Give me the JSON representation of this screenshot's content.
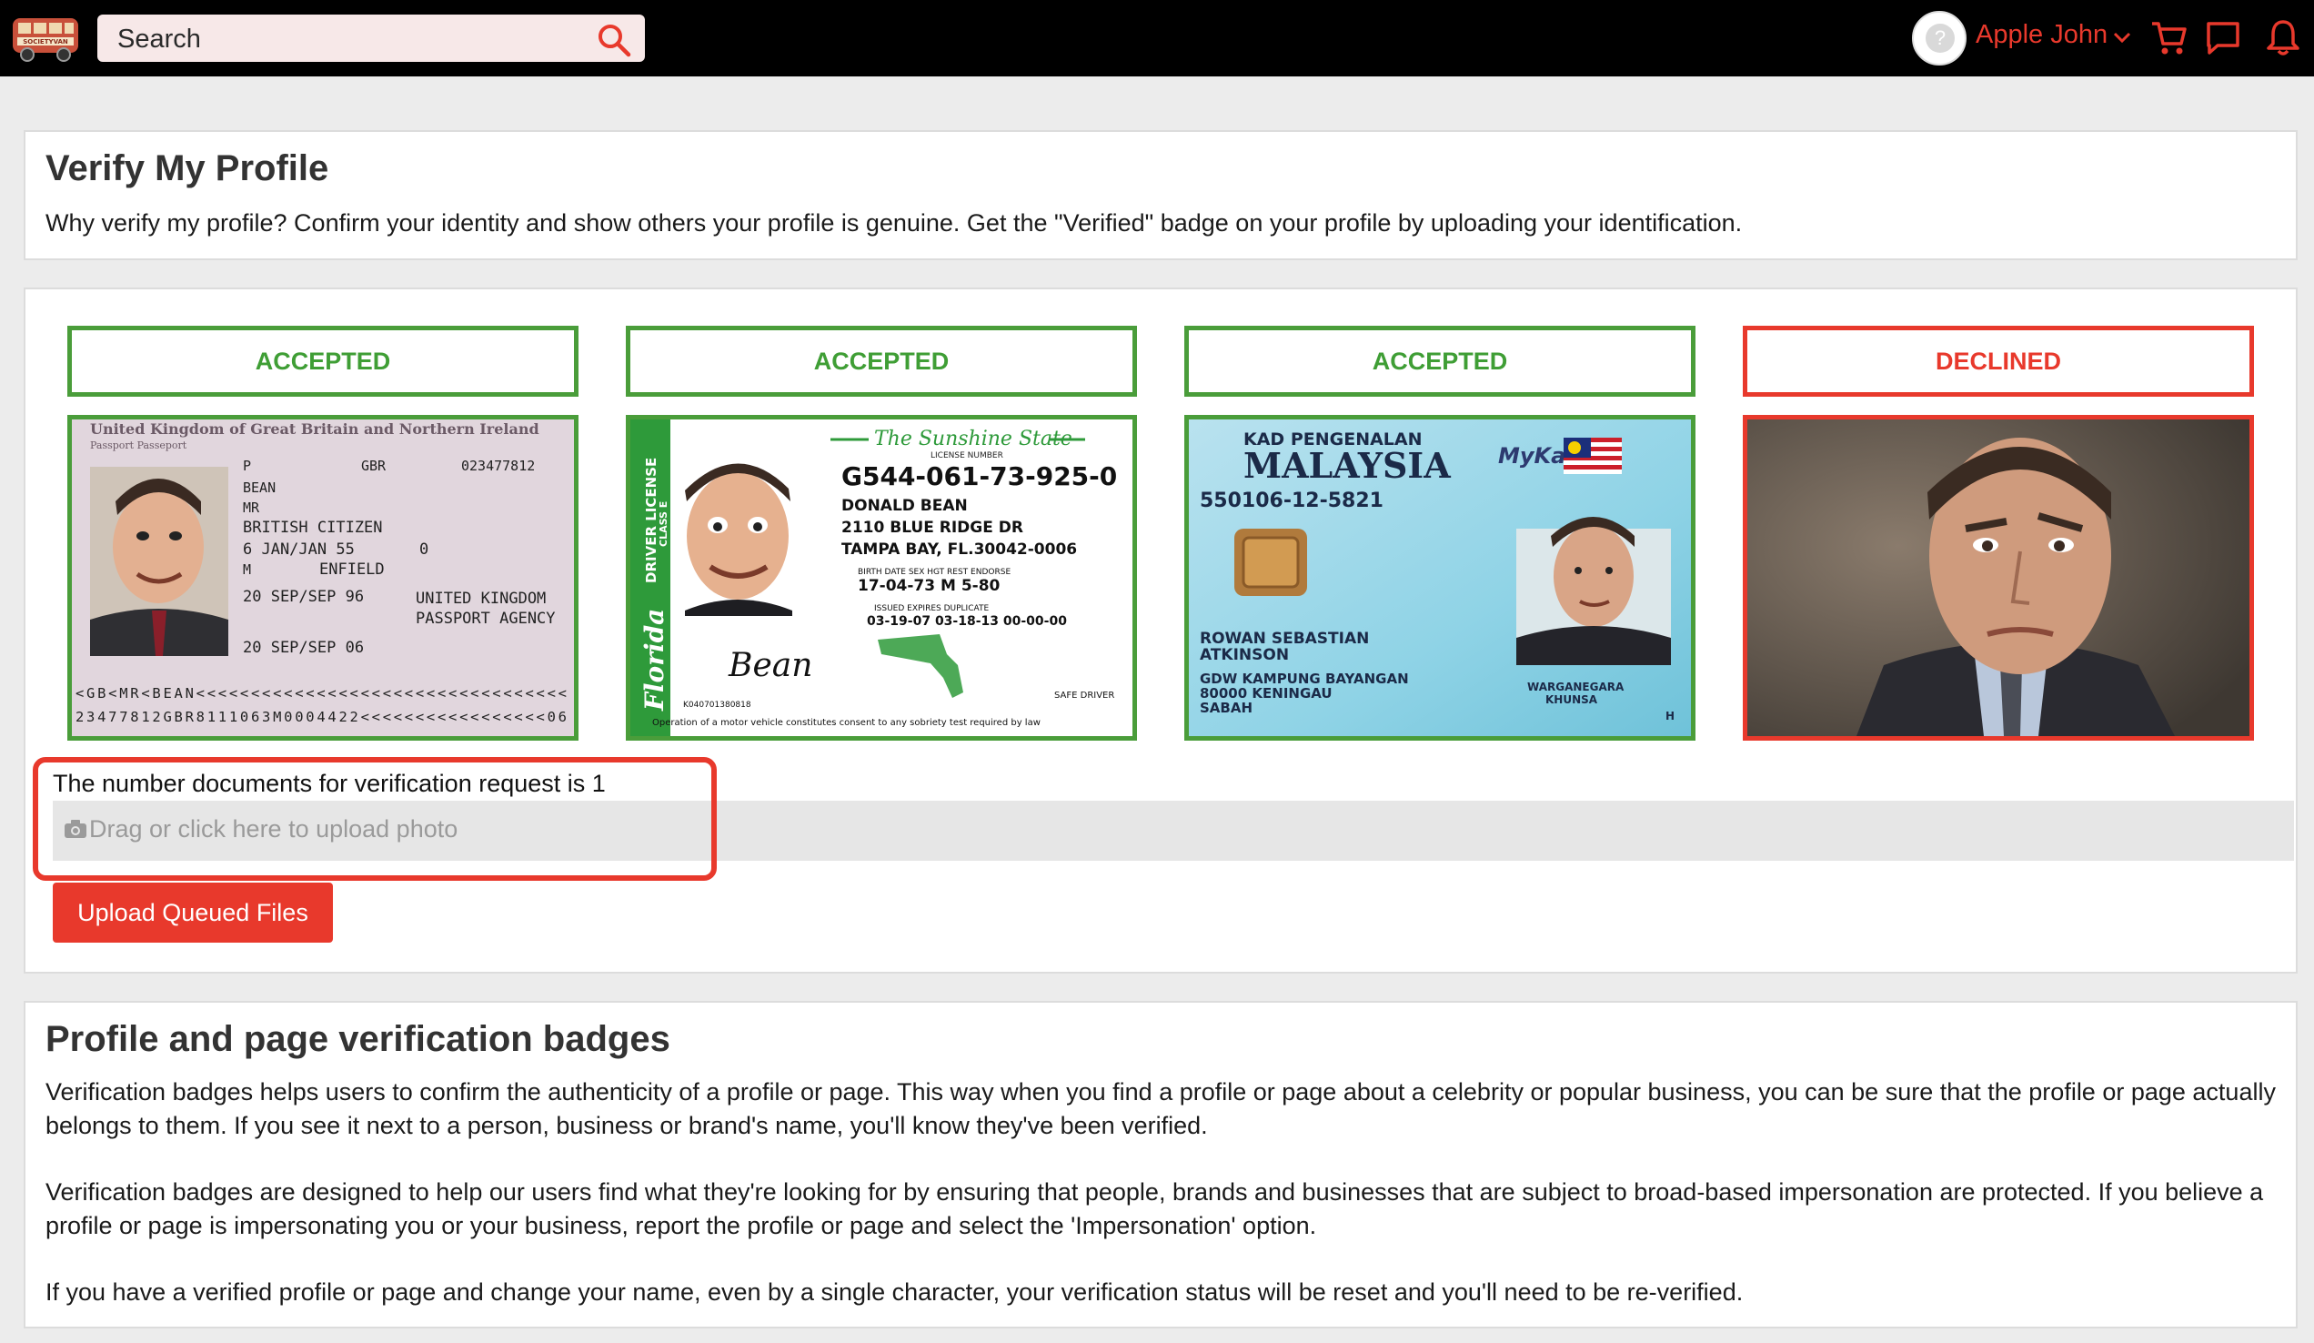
{
  "topbar": {
    "logo_icon": "bus-logo-icon",
    "logo_text": "SOCIETYVAN",
    "search_placeholder": "Search",
    "user_name": "Apple John",
    "accent_color": "#e8392c"
  },
  "intro": {
    "title": "Verify My Profile",
    "description": "Why verify my profile? Confirm your identity and show others your profile is genuine. Get the \"Verified\" badge on your profile by uploading your identification."
  },
  "documents": [
    {
      "status": "ACCEPTED",
      "kind": "passport",
      "lines": {
        "header": "United Kingdom of Great Britain and Northern Ireland",
        "sub": "Passport Passeport",
        "type": "P",
        "code": "GBR",
        "number": "023477812",
        "surname": "BEAN",
        "title": "MR",
        "nationality": "BRITISH CITIZEN",
        "dob": "6 JAN/JAN 55",
        "num0": "0",
        "sex": "M",
        "place": "ENFIELD",
        "issued": "20 SEP/SEP 96",
        "authority1": "UNITED KINGDOM",
        "authority2": "PASSPORT AGENCY",
        "expiry": "20 SEP/SEP 06",
        "mrz1": "<GB<MR<BEAN<<<<<<<<<<<<<<<<<<<<<<<<<<<<<<<<<<",
        "mrz2": "23477812GBR8111063M0004422<<<<<<<<<<<<<<<<<06"
      }
    },
    {
      "status": "ACCEPTED",
      "kind": "license",
      "lines": {
        "state": "The Sunshine State",
        "license_label": "LICENSE NUMBER",
        "number": "G544-061-73-925-0",
        "name": "DONALD BEAN",
        "addr1": "2110 BLUE RIDGE DR",
        "addr2": "TAMPA BAY, FL.30042-0006",
        "labels": "BIRTH DATE   SEX   HGT   REST      ENDORSE",
        "birth": "17-04-73 M  5-80",
        "labels2": "ISSUED        EXPIRES       DUPLICATE",
        "dates": "03-19-07     03-18-13      00-00-00",
        "side": "DRIVER LICENSE",
        "side2": "CLASS E",
        "florida": "Florida",
        "sign": "Bean",
        "safe": "SAFE DRIVER",
        "serial": "K040701380818",
        "footer": "Operation of a motor vehicle constitutes consent to any sobriety test required by law"
      }
    },
    {
      "status": "ACCEPTED",
      "kind": "mykad",
      "lines": {
        "top": "KAD PENGENALAN",
        "country": "MALAYSIA",
        "brand": "MyKad",
        "id": "550106-12-5821",
        "name1": "ROWAN SEBASTIAN",
        "name2": "ATKINSON",
        "addr1": "GDW KAMPUNG BAYANGAN",
        "addr2": "80000 KENINGAU",
        "addr3": "SABAH",
        "cit1": "WARGANEGARA",
        "cit2": "KHUNSA",
        "h": "H"
      }
    },
    {
      "status": "DECLINED",
      "kind": "photo"
    }
  ],
  "upload": {
    "count_text": "The number documents for verification request is 1",
    "drop_hint": "Drag or click here to upload photo",
    "button_label": "Upload Queued Files"
  },
  "badges": {
    "title": "Profile and page verification badges",
    "p1": "Verification badges helps users to confirm the authenticity of a profile or page. This way when you find a profile or page about a celebrity or popular business, you can be sure that the profile or page actually belongs to them. If you see it next to a person, business or brand's name, you'll know they've been verified.",
    "p2": "Verification badges are designed to help our users find what they're looking for by ensuring that people, brands and businesses that are subject to broad-based impersonation are protected. If you believe a profile or page is impersonating you or your business, report the profile or page and select the 'Impersonation' option.",
    "p3": "If you have a verified profile or page and change your name, even by a single character, your verification status will be reset and you'll need to be re-verified."
  }
}
